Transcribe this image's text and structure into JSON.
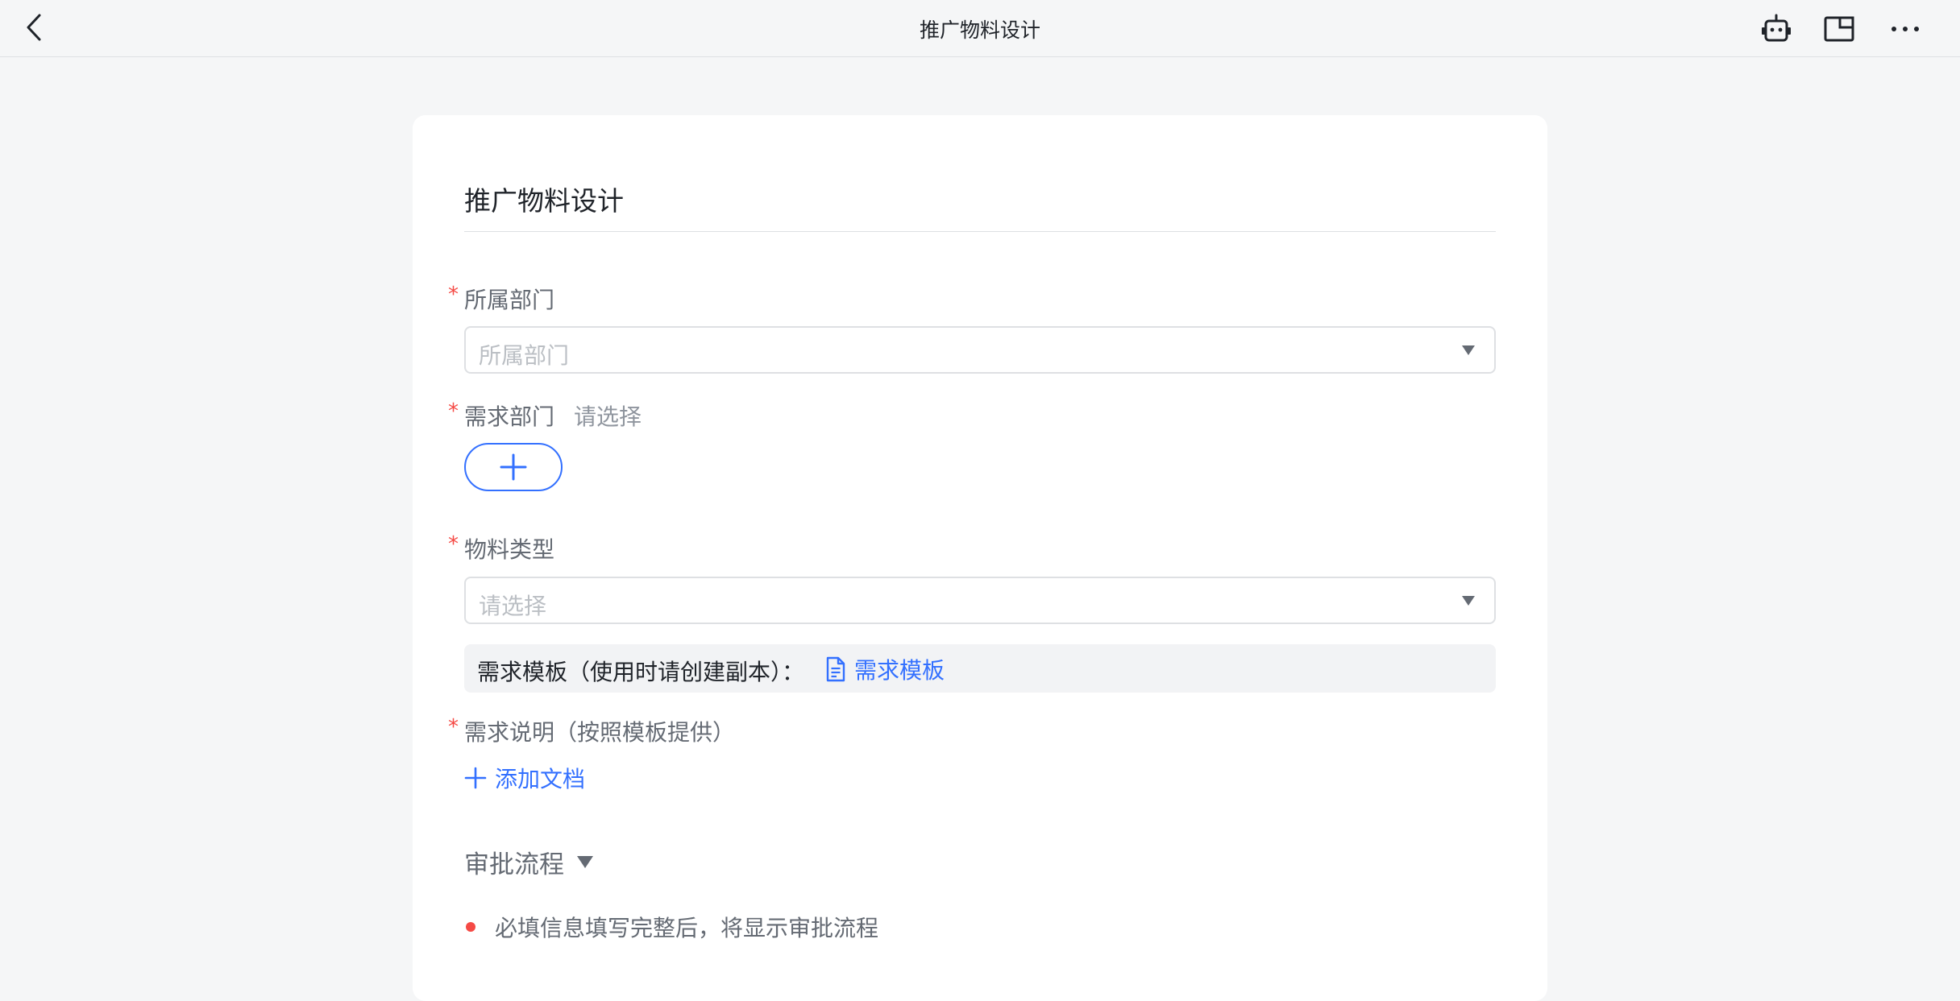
{
  "header": {
    "title": "推广物料设计",
    "back_icon": "chevron-left-icon",
    "actions": [
      "robot-icon",
      "window-icon",
      "more-icon"
    ]
  },
  "form": {
    "title": "推广物料设计",
    "required_mark": "*",
    "fields": {
      "department": {
        "label": "所属部门",
        "placeholder": "所属部门"
      },
      "demand_department": {
        "label": "需求部门",
        "hint": "请选择",
        "add_icon": "plus-icon"
      },
      "material_type": {
        "label": "物料类型",
        "placeholder": "请选择"
      },
      "template": {
        "text": "需求模板（使用时请创建副本）：",
        "link_label": "需求模板",
        "link_icon": "document-icon"
      },
      "description": {
        "label": "需求说明（按照模板提供）",
        "add_doc_label": "添加文档"
      }
    },
    "approval": {
      "title": "审批流程",
      "notice": "必填信息填写完整后，将显示审批流程"
    }
  },
  "colors": {
    "accent": "#3370ff",
    "required": "#f54a45",
    "text_primary": "#1f2329",
    "text_secondary": "#646a73",
    "placeholder": "#bbbfc4"
  }
}
